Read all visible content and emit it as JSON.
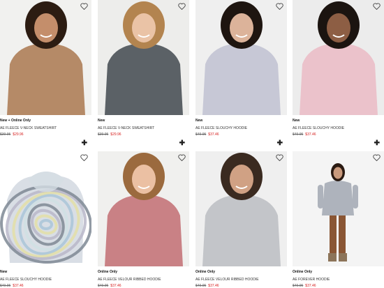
{
  "products": [
    {
      "badge": "New + Online Only",
      "name": "AE Fleece V-Neck Sweatshirt",
      "was": "$39.95",
      "now": "$29.96",
      "colors": {
        "bg": "#f1f1ef",
        "top": "#b58a67",
        "hair": "#2c1c12",
        "skin": "#c48e6b",
        "bottom": "#7d5a40"
      }
    },
    {
      "badge": "New",
      "name": "AE Fleece V-Neck Sweatshirt",
      "was": "$39.95",
      "now": "$29.96",
      "colors": {
        "bg": "#ededeb",
        "top": "#5b6166",
        "hair": "#b3844f",
        "skin": "#eac3a6",
        "bottom": "#a9c2d8"
      }
    },
    {
      "badge": "New",
      "name": "AE Fleece Slouchy Hoodie",
      "was": "$49.95",
      "now": "$37.46",
      "colors": {
        "bg": "#efefef",
        "top": "#c7c8d6",
        "hair": "#1e1510",
        "skin": "#dcb39a",
        "bottom": "#7fa3c8"
      }
    },
    {
      "badge": "New",
      "name": "AE Fleece Slouchy Hoodie",
      "was": "$49.95",
      "now": "$37.46",
      "colors": {
        "bg": "#ececec",
        "top": "#ebc2cb",
        "hair": "#1b1410",
        "skin": "#8d5e44",
        "bottom": "#8fb0cf"
      }
    },
    {
      "badge": "New",
      "name": "AE Fleece Slouchy Hoodie",
      "was": "$49.95",
      "now": "$37.46",
      "colors": {
        "bg": "#ffffff",
        "top": "#d9dee5",
        "hair": "#ffffff",
        "skin": "#ffffff",
        "bottom": "#ffffff"
      }
    },
    {
      "badge": "Online Only",
      "name": "AE Fleece Velour Ribbed Hoodie",
      "was": "$49.95",
      "now": "$37.46",
      "colors": {
        "bg": "#f0f0ee",
        "top": "#c98185",
        "hair": "#9b6a3e",
        "skin": "#ebc0a3",
        "bottom": "#6f5147"
      }
    },
    {
      "badge": "Online Only",
      "name": "AE Fleece Velour Ribbed Hoodie",
      "was": "$49.95",
      "now": "$37.46",
      "colors": {
        "bg": "#efefef",
        "top": "#c3c5c9",
        "hair": "#3a2a20",
        "skin": "#d0a184",
        "bottom": "#536d8f"
      }
    },
    {
      "badge": "Online Only",
      "name": "AE Forever Hoodie",
      "was": "$49.95",
      "now": "$37.46",
      "colors": {
        "bg": "#f4f4f4",
        "top": "#aeb3bc",
        "hair": "#2a1a12",
        "skin": "#c99a7d",
        "bottom": "#8a5634"
      }
    }
  ]
}
